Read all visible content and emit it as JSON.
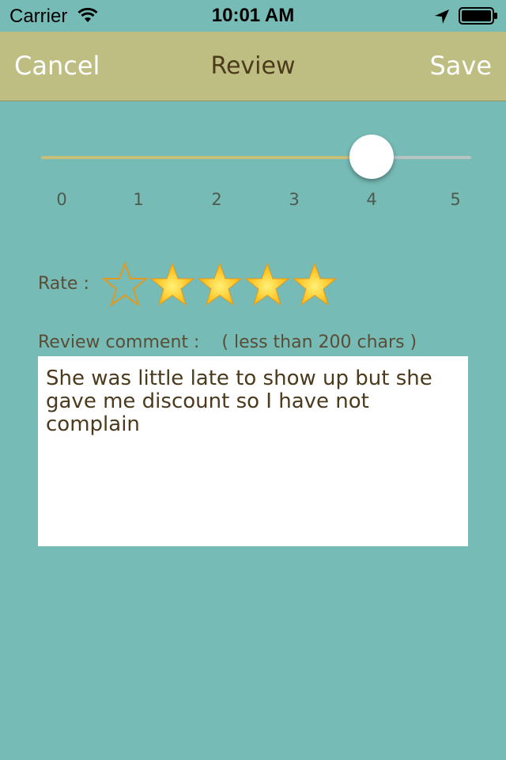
{
  "status_bar": {
    "carrier": "Carrier",
    "time": "10:01 AM",
    "icons": [
      "wifi-icon",
      "location-icon",
      "battery-icon"
    ]
  },
  "nav": {
    "cancel_label": "Cancel",
    "title": "Review",
    "save_label": "Save"
  },
  "slider": {
    "ticks": [
      "0",
      "1",
      "2",
      "3",
      "4",
      "5"
    ],
    "min": 0,
    "max": 5,
    "value": 4
  },
  "rating": {
    "label": "Rate :",
    "max": 5,
    "stars": [
      "empty",
      "filled",
      "filled",
      "filled",
      "filled"
    ]
  },
  "comment": {
    "label": "Review comment :    ( less than 200 chars )",
    "text": "She was little late to show up but she gave me discount so I have not complain"
  },
  "colors": {
    "background": "#76bbb6",
    "nav_bar": "#bebd82",
    "nav_title": "#4b3a1c",
    "star_fill": "#ffb000",
    "star_outline": "#e09a20",
    "text_brown": "#5a4d36"
  }
}
